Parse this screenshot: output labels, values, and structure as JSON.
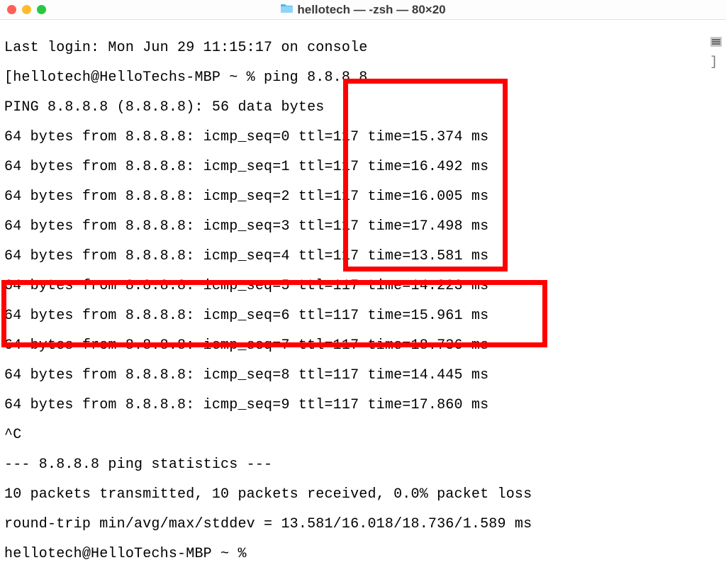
{
  "window": {
    "title": "hellotech — -zsh — 80×20"
  },
  "terminal": {
    "last_login": "Last login: Mon Jun 29 11:15:17 on console",
    "prompt1_open": "[",
    "prompt1": "hellotech@HelloTechs-MBP ~ % ping 8.8.8.8",
    "ping_header": "PING 8.8.8.8 (8.8.8.8): 56 data bytes",
    "replies": [
      "64 bytes from 8.8.8.8: icmp_seq=0 ttl=117 time=15.374 ms",
      "64 bytes from 8.8.8.8: icmp_seq=1 ttl=117 time=16.492 ms",
      "64 bytes from 8.8.8.8: icmp_seq=2 ttl=117 time=16.005 ms",
      "64 bytes from 8.8.8.8: icmp_seq=3 ttl=117 time=17.498 ms",
      "64 bytes from 8.8.8.8: icmp_seq=4 ttl=117 time=13.581 ms",
      "64 bytes from 8.8.8.8: icmp_seq=5 ttl=117 time=14.223 ms",
      "64 bytes from 8.8.8.8: icmp_seq=6 ttl=117 time=15.961 ms",
      "64 bytes from 8.8.8.8: icmp_seq=7 ttl=117 time=18.736 ms",
      "64 bytes from 8.8.8.8: icmp_seq=8 ttl=117 time=14.445 ms",
      "64 bytes from 8.8.8.8: icmp_seq=9 ttl=117 time=17.860 ms"
    ],
    "interrupt": "^C",
    "stats_header": "--- 8.8.8.8 ping statistics ---",
    "stats_packets": "10 packets transmitted, 10 packets received, 0.0% packet loss",
    "stats_rtt": "round-trip min/avg/max/stddev = 13.581/16.018/18.736/1.589 ms",
    "prompt2": "hellotech@HelloTechs-MBP ~ % "
  },
  "right_bracket": "]"
}
